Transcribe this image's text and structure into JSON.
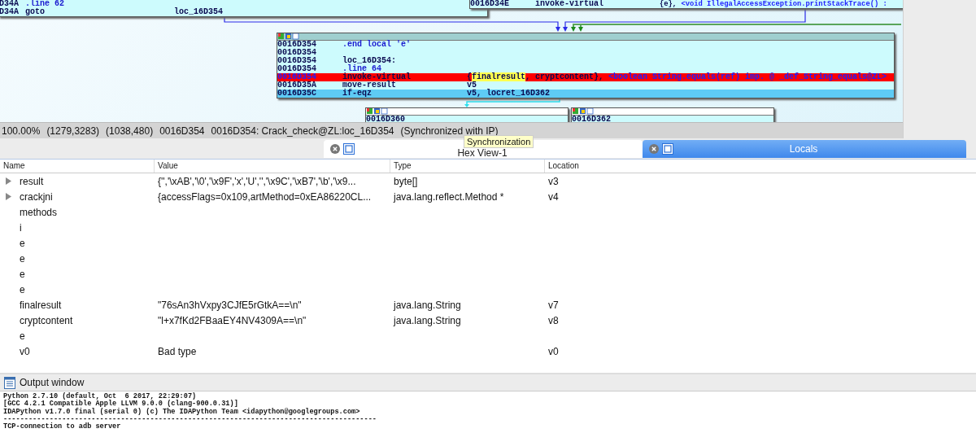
{
  "graph": {
    "nodes": [
      {
        "header": false,
        "lines": [
          {
            "address": "D34A",
            "op": ".line 62",
            "kind": "directive",
            "current": false,
            "selected": false
          },
          {
            "address": "D34A",
            "op": "goto",
            "kind": "instr",
            "current": false,
            "selected": false,
            "args": [
              {
                "text": "loc_16D354",
                "kind": "plain"
              }
            ]
          }
        ]
      },
      {
        "header": false,
        "lines": [
          {
            "address": "0016D34E",
            "op": "invoke-virtual",
            "kind": "instr",
            "current": false,
            "selected": false,
            "args": [
              {
                "text": "{e}, ",
                "kind": "plain"
              },
              {
                "text": "<void IllegalAccessException.printStackTrace() :",
                "kind": "ref"
              }
            ]
          }
        ]
      },
      {
        "header": true,
        "lines": [
          {
            "address": "0016D354",
            "op": ".end local 'e'",
            "kind": "directive",
            "current": false,
            "selected": false
          },
          {
            "address": "0016D354",
            "current": false,
            "selected": false
          },
          {
            "address": "0016D354",
            "op": "loc_16D354:",
            "kind": "label",
            "current": false,
            "selected": false
          },
          {
            "address": "0016D354",
            "op": ".line 64",
            "kind": "directive",
            "current": false,
            "selected": false
          },
          {
            "address": "0016D354",
            "op": "invoke-virtual",
            "kind": "instr",
            "current": true,
            "selected": false,
            "args": [
              {
                "text": "{",
                "kind": "plain"
              },
              {
                "text": "finalresult",
                "kind": "var"
              },
              {
                "text": ", cryptcontent}, ",
                "kind": "plain"
              },
              {
                "text": "<boolean String.equals(ref) imp. @ _def_String_equals@ZL>",
                "kind": "ref"
              }
            ]
          },
          {
            "address": "0016D35A",
            "op": "move-result",
            "kind": "instr",
            "current": false,
            "selected": false,
            "args": [
              {
                "text": "v5",
                "kind": "plain"
              }
            ]
          },
          {
            "address": "0016D35C",
            "op": "if-eqz",
            "kind": "instr",
            "current": false,
            "selected": true,
            "args": [
              {
                "text": "v5, locret_16D362",
                "kind": "plain"
              }
            ]
          }
        ]
      },
      {
        "header": true,
        "lines": [
          {
            "address": "0016D360",
            "current": false,
            "selected": false
          }
        ]
      },
      {
        "header": true,
        "lines": [
          {
            "address": "0016D362",
            "current": false,
            "selected": false
          }
        ]
      }
    ]
  },
  "status_bar": [
    "100.00%",
    "(1279,3283)",
    "(1038,480)",
    "0016D354",
    "0016D354: Crack_check@ZL:loc_16D354",
    "(Synchronized with IP)"
  ],
  "tabs": [
    {
      "label": "Hex View-1",
      "selected": false
    },
    {
      "label": "Locals",
      "selected": true
    }
  ],
  "tooltip": "Synchronization",
  "table": {
    "columns": [
      "Name",
      "Value",
      "Type",
      "Location"
    ],
    "rows": [
      {
        "expandable": true,
        "cells": [
          "result",
          "{'','\\xAB','\\0','\\x9F','x','U','','\\x9C','\\xB7','\\b','\\x9...",
          "byte[]",
          "v3"
        ]
      },
      {
        "expandable": true,
        "cells": [
          "crackjni",
          "{accessFlags=0x109,artMethod=0xEA86220CL...",
          "java.lang.reflect.Method *",
          "v4"
        ]
      },
      {
        "expandable": false,
        "cells": [
          "methods"
        ]
      },
      {
        "expandable": false,
        "cells": [
          "i"
        ]
      },
      {
        "expandable": false,
        "cells": [
          "e"
        ]
      },
      {
        "expandable": false,
        "cells": [
          "e"
        ]
      },
      {
        "expandable": false,
        "cells": [
          "e"
        ]
      },
      {
        "expandable": false,
        "cells": [
          "e"
        ]
      },
      {
        "expandable": false,
        "cells": [
          "finalresult",
          "\"76sAn3hVxpy3CJfE5rGtkA==\\n\"",
          "java.lang.String",
          "v7"
        ]
      },
      {
        "expandable": false,
        "cells": [
          "cryptcontent",
          "\"l+x7fKd2FBaaEY4NV4309A==\\n\"",
          "java.lang.String",
          "v8"
        ]
      },
      {
        "expandable": false,
        "cells": [
          "e"
        ]
      },
      {
        "expandable": false,
        "cells": [
          "v0",
          "Bad type",
          null,
          "v0"
        ]
      }
    ]
  },
  "output": {
    "title": "Output window",
    "lines": [
      "Python 2.7.10 (default, Oct  6 2017, 22:29:07)",
      "[GCC 4.2.1 Compatible Apple LLVM 9.0.0 (clang-900.0.31)]",
      "IDAPython v1.7.0 final (serial 0) (c) The IDAPython Team <idapython@googlegroups.com>",
      "-----------------------------------------------------------------------------------------",
      "TCP-connection to adb server"
    ]
  }
}
